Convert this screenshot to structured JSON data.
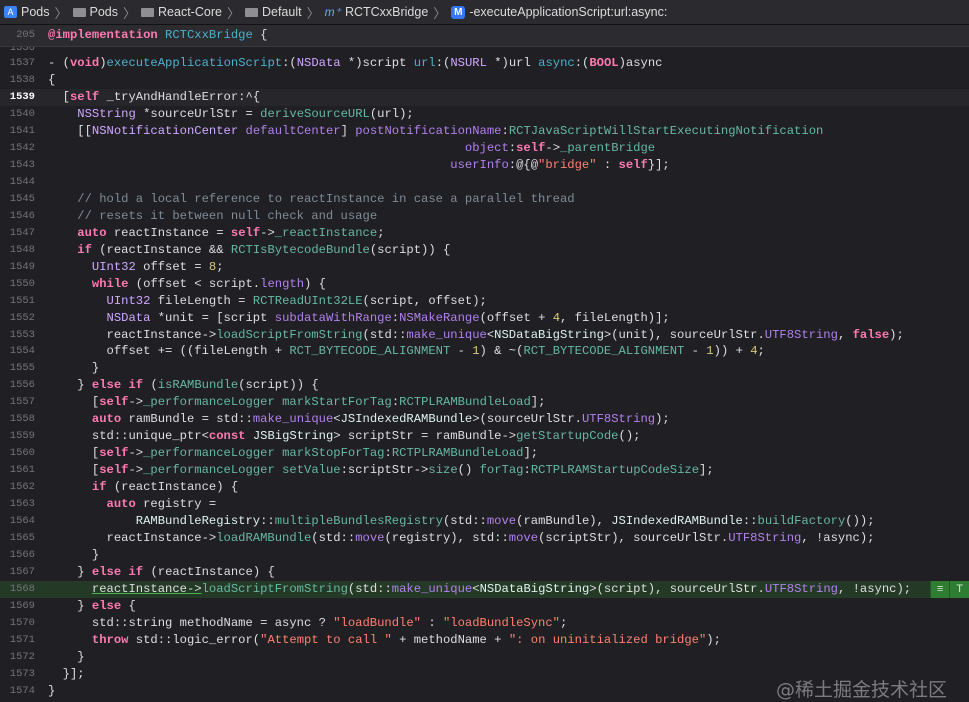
{
  "breadcrumb": [
    {
      "icon": "project-icon",
      "label": "Pods"
    },
    {
      "icon": "folder-icon",
      "label": "Pods"
    },
    {
      "icon": "folder-icon",
      "label": "React-Core"
    },
    {
      "icon": "folder-icon",
      "label": "Default"
    },
    {
      "icon": "class-file-icon",
      "label": "RCTCxxBridge"
    },
    {
      "icon": "method-icon",
      "label": "-executeApplicationScript:url:async:"
    }
  ],
  "sticky_header": {
    "line": "205",
    "tokens": [
      [
        "k",
        "@implementation"
      ],
      [
        "",
        ""
      ],
      [
        "",
        ""
      ],
      [
        "d",
        " RCTCxxBridge"
      ],
      [
        "",
        " {"
      ]
    ]
  },
  "partial_line": "1536",
  "current_line": "1539",
  "highlighted_line": "1568",
  "issue_badge": {
    "icon": "list-icon",
    "text": "T"
  },
  "watermark": "@稀土掘金技术社区",
  "lines": [
    {
      "n": "1537",
      "tokens": [
        [
          "",
          "- ("
        ],
        [
          "k",
          "void"
        ],
        [
          "",
          ")"
        ],
        [
          "d",
          "executeApplicationScript"
        ],
        [
          "",
          ":("
        ],
        [
          "t",
          "NSData"
        ],
        [
          "",
          " *)script "
        ],
        [
          "d",
          "url"
        ],
        [
          "",
          ":("
        ],
        [
          "t",
          "NSURL"
        ],
        [
          "",
          " *)url "
        ],
        [
          "d",
          "async"
        ],
        [
          "",
          ":("
        ],
        [
          "k",
          "BOOL"
        ],
        [
          "",
          ")async"
        ]
      ]
    },
    {
      "n": "1538",
      "tokens": [
        [
          "",
          "{"
        ]
      ]
    },
    {
      "n": "1539",
      "tokens": [
        [
          "",
          "  ["
        ],
        [
          "k",
          "self"
        ],
        [
          "",
          " _tryAndHandleError:^{"
        ]
      ]
    },
    {
      "n": "1540",
      "tokens": [
        [
          "",
          "    "
        ],
        [
          "t",
          "NSString"
        ],
        [
          "",
          " *sourceUrlStr = "
        ],
        [
          "pf",
          "deriveSourceURL"
        ],
        [
          "",
          "(url);"
        ]
      ]
    },
    {
      "n": "1541",
      "tokens": [
        [
          "",
          "    [["
        ],
        [
          "t",
          "NSNotificationCenter"
        ],
        [
          "",
          " "
        ],
        [
          "f",
          "defaultCenter"
        ],
        [
          "",
          "] "
        ],
        [
          "f",
          "postNotificationName"
        ],
        [
          "",
          ":"
        ],
        [
          "pf",
          "RCTJavaScriptWillStartExecutingNotification"
        ]
      ]
    },
    {
      "n": "1542",
      "tokens": [
        [
          "",
          "                                                         "
        ],
        [
          "f",
          "object"
        ],
        [
          "",
          ":"
        ],
        [
          "k",
          "self"
        ],
        [
          "",
          "->"
        ],
        [
          "pm",
          "_parentBridge"
        ]
      ]
    },
    {
      "n": "1543",
      "tokens": [
        [
          "",
          "                                                       "
        ],
        [
          "f",
          "userInfo"
        ],
        [
          "",
          ":@{@"
        ],
        [
          "s",
          "\"bridge\""
        ],
        [
          "",
          " : "
        ],
        [
          "k",
          "self"
        ],
        [
          "",
          "}];"
        ]
      ]
    },
    {
      "n": "1544",
      "tokens": []
    },
    {
      "n": "1545",
      "tokens": [
        [
          "",
          "    "
        ],
        [
          "c",
          "// hold a local reference to reactInstance in case a parallel thread"
        ]
      ]
    },
    {
      "n": "1546",
      "tokens": [
        [
          "",
          "    "
        ],
        [
          "c",
          "// resets it between null check and usage"
        ]
      ]
    },
    {
      "n": "1547",
      "tokens": [
        [
          "",
          "    "
        ],
        [
          "k",
          "auto"
        ],
        [
          "",
          " reactInstance = "
        ],
        [
          "k",
          "self"
        ],
        [
          "",
          "->"
        ],
        [
          "pm",
          "_reactInstance"
        ],
        [
          "",
          ";"
        ]
      ]
    },
    {
      "n": "1548",
      "tokens": [
        [
          "",
          "    "
        ],
        [
          "k",
          "if"
        ],
        [
          "",
          " (reactInstance && "
        ],
        [
          "pf",
          "RCTIsBytecodeBundle"
        ],
        [
          "",
          "(script)) {"
        ]
      ]
    },
    {
      "n": "1549",
      "tokens": [
        [
          "",
          "      "
        ],
        [
          "t",
          "UInt32"
        ],
        [
          "",
          " offset = "
        ],
        [
          "n",
          "8"
        ],
        [
          "",
          ";"
        ]
      ]
    },
    {
      "n": "1550",
      "tokens": [
        [
          "",
          "      "
        ],
        [
          "k",
          "while"
        ],
        [
          "",
          " (offset < script."
        ],
        [
          "f",
          "length"
        ],
        [
          "",
          ") {"
        ]
      ]
    },
    {
      "n": "1551",
      "tokens": [
        [
          "",
          "        "
        ],
        [
          "t",
          "UInt32"
        ],
        [
          "",
          " fileLength = "
        ],
        [
          "pf",
          "RCTReadUInt32LE"
        ],
        [
          "",
          "(script, offset);"
        ]
      ]
    },
    {
      "n": "1552",
      "tokens": [
        [
          "",
          "        "
        ],
        [
          "t",
          "NSData"
        ],
        [
          "",
          " *unit = [script "
        ],
        [
          "f",
          "subdataWithRange"
        ],
        [
          "",
          ":"
        ],
        [
          "f",
          "NSMakeRange"
        ],
        [
          "",
          "(offset + "
        ],
        [
          "n",
          "4"
        ],
        [
          "",
          ", fileLength)];"
        ]
      ]
    },
    {
      "n": "1553",
      "tokens": [
        [
          "",
          "        reactInstance->"
        ],
        [
          "pf",
          "loadScriptFromString"
        ],
        [
          "",
          "(std::"
        ],
        [
          "f",
          "make_unique"
        ],
        [
          "",
          "<"
        ],
        [
          "p",
          "NSDataBigString"
        ],
        [
          "",
          ">(unit), sourceUrlStr."
        ],
        [
          "f",
          "UTF8String"
        ],
        [
          "",
          ", "
        ],
        [
          "k",
          "false"
        ],
        [
          "",
          ");"
        ]
      ]
    },
    {
      "n": "1554",
      "tokens": [
        [
          "",
          "        offset += ((fileLength + "
        ],
        [
          "pf",
          "RCT_BYTECODE_ALIGNMENT"
        ],
        [
          "",
          " - "
        ],
        [
          "n",
          "1"
        ],
        [
          "",
          ") & ~("
        ],
        [
          "pf",
          "RCT_BYTECODE_ALIGNMENT"
        ],
        [
          "",
          " - "
        ],
        [
          "n",
          "1"
        ],
        [
          "",
          "))"
        ],
        [
          "",
          " + "
        ],
        [
          "n",
          "4"
        ],
        [
          "",
          ";"
        ]
      ]
    },
    {
      "n": "1555",
      "tokens": [
        [
          "",
          "      }"
        ]
      ]
    },
    {
      "n": "1556",
      "tokens": [
        [
          "",
          "    } "
        ],
        [
          "k",
          "else"
        ],
        [
          "",
          " "
        ],
        [
          "k",
          "if"
        ],
        [
          "",
          " ("
        ],
        [
          "pf",
          "isRAMBundle"
        ],
        [
          "",
          "(script)) {"
        ]
      ]
    },
    {
      "n": "1557",
      "tokens": [
        [
          "",
          "      ["
        ],
        [
          "k",
          "self"
        ],
        [
          "",
          "->"
        ],
        [
          "pm",
          "_performanceLogger"
        ],
        [
          "",
          " "
        ],
        [
          "pf",
          "markStartForTag"
        ],
        [
          "",
          ":"
        ],
        [
          "pf",
          "RCTPLRAMBundleLoad"
        ],
        [
          "",
          "];"
        ]
      ]
    },
    {
      "n": "1558",
      "tokens": [
        [
          "",
          "      "
        ],
        [
          "k",
          "auto"
        ],
        [
          "",
          " ramBundle = std::"
        ],
        [
          "f",
          "make_unique"
        ],
        [
          "",
          "<"
        ],
        [
          "p",
          "JSIndexedRAMBundle"
        ],
        [
          "",
          ">(sourceUrlStr."
        ],
        [
          "f",
          "UTF8String"
        ],
        [
          "",
          ");"
        ]
      ]
    },
    {
      "n": "1559",
      "tokens": [
        [
          "",
          "      std::unique_ptr<"
        ],
        [
          "k",
          "const"
        ],
        [
          "",
          " "
        ],
        [
          "p",
          "JSBigString"
        ],
        [
          "",
          "> scriptStr = ramBundle->"
        ],
        [
          "pf",
          "getStartupCode"
        ],
        [
          "",
          "();"
        ]
      ]
    },
    {
      "n": "1560",
      "tokens": [
        [
          "",
          "      ["
        ],
        [
          "k",
          "self"
        ],
        [
          "",
          "->"
        ],
        [
          "pm",
          "_performanceLogger"
        ],
        [
          "",
          " "
        ],
        [
          "pf",
          "markStopForTag"
        ],
        [
          "",
          ":"
        ],
        [
          "pf",
          "RCTPLRAMBundleLoad"
        ],
        [
          "",
          "];"
        ]
      ]
    },
    {
      "n": "1561",
      "tokens": [
        [
          "",
          "      ["
        ],
        [
          "k",
          "self"
        ],
        [
          "",
          "->"
        ],
        [
          "pm",
          "_performanceLogger"
        ],
        [
          "",
          " "
        ],
        [
          "pf",
          "setValue"
        ],
        [
          "",
          ":scriptStr->"
        ],
        [
          "pf",
          "size"
        ],
        [
          "",
          "() "
        ],
        [
          "pf",
          "forTag"
        ],
        [
          "",
          ":"
        ],
        [
          "pf",
          "RCTPLRAMStartupCodeSize"
        ],
        [
          "",
          "];"
        ]
      ]
    },
    {
      "n": "1562",
      "tokens": [
        [
          "",
          "      "
        ],
        [
          "k",
          "if"
        ],
        [
          "",
          " (reactInstance) {"
        ]
      ]
    },
    {
      "n": "1563",
      "tokens": [
        [
          "",
          "        "
        ],
        [
          "k",
          "auto"
        ],
        [
          "",
          " registry ="
        ]
      ]
    },
    {
      "n": "1564",
      "tokens": [
        [
          "",
          "            "
        ],
        [
          "p",
          "RAMBundleRegistry"
        ],
        [
          "",
          "::"
        ],
        [
          "pf",
          "multipleBundlesRegistry"
        ],
        [
          "",
          "(std::"
        ],
        [
          "f",
          "move"
        ],
        [
          "",
          "(ramBundle), "
        ],
        [
          "p",
          "JSIndexedRAMBundle"
        ],
        [
          "",
          "::"
        ],
        [
          "pf",
          "buildFactory"
        ],
        [
          "",
          "());"
        ]
      ]
    },
    {
      "n": "1565",
      "tokens": [
        [
          "",
          "        reactInstance->"
        ],
        [
          "pf",
          "loadRAMBundle"
        ],
        [
          "",
          "(std::"
        ],
        [
          "f",
          "move"
        ],
        [
          "",
          "(registry), std::"
        ],
        [
          "f",
          "move"
        ],
        [
          "",
          "(scriptStr), sourceUrlStr."
        ],
        [
          "f",
          "UTF8String"
        ],
        [
          "",
          ", !async);"
        ]
      ]
    },
    {
      "n": "1566",
      "tokens": [
        [
          "",
          "      }"
        ]
      ]
    },
    {
      "n": "1567",
      "tokens": [
        [
          "",
          "    } "
        ],
        [
          "k",
          "else"
        ],
        [
          "",
          " "
        ],
        [
          "k",
          "if"
        ],
        [
          "",
          " (reactInstance) {"
        ]
      ]
    },
    {
      "n": "1568",
      "tokens": [
        [
          "",
          "      "
        ],
        [
          "u",
          "reactInstance->"
        ],
        [
          "pf",
          "loadScriptFromString"
        ],
        [
          "",
          "(std::"
        ],
        [
          "f",
          "make_unique"
        ],
        [
          "",
          "<"
        ],
        [
          "p",
          "NSDataBigString"
        ],
        [
          "",
          ">(script), sourceUrlStr."
        ],
        [
          "f",
          "UTF8String"
        ],
        [
          "",
          ", !async);"
        ]
      ]
    },
    {
      "n": "1569",
      "tokens": [
        [
          "",
          "    } "
        ],
        [
          "k",
          "else"
        ],
        [
          "",
          " {"
        ]
      ]
    },
    {
      "n": "1570",
      "tokens": [
        [
          "",
          "      std::string methodName = async ? "
        ],
        [
          "s",
          "\"loadBundle\""
        ],
        [
          "",
          " : "
        ],
        [
          "s",
          "\"loadBundleSync\""
        ],
        [
          "",
          ";"
        ]
      ]
    },
    {
      "n": "1571",
      "tokens": [
        [
          "",
          "      "
        ],
        [
          "k",
          "throw"
        ],
        [
          "",
          " std::logic_error("
        ],
        [
          "s",
          "\"Attempt to call \""
        ],
        [
          "",
          " + methodName + "
        ],
        [
          "s",
          "\": on uninitialized bridge\""
        ],
        [
          "",
          ");"
        ]
      ]
    },
    {
      "n": "1572",
      "tokens": [
        [
          "",
          "    }"
        ]
      ]
    },
    {
      "n": "1573",
      "tokens": [
        [
          "",
          "  }];"
        ]
      ]
    },
    {
      "n": "1574",
      "tokens": [
        [
          "",
          "}"
        ]
      ]
    }
  ]
}
